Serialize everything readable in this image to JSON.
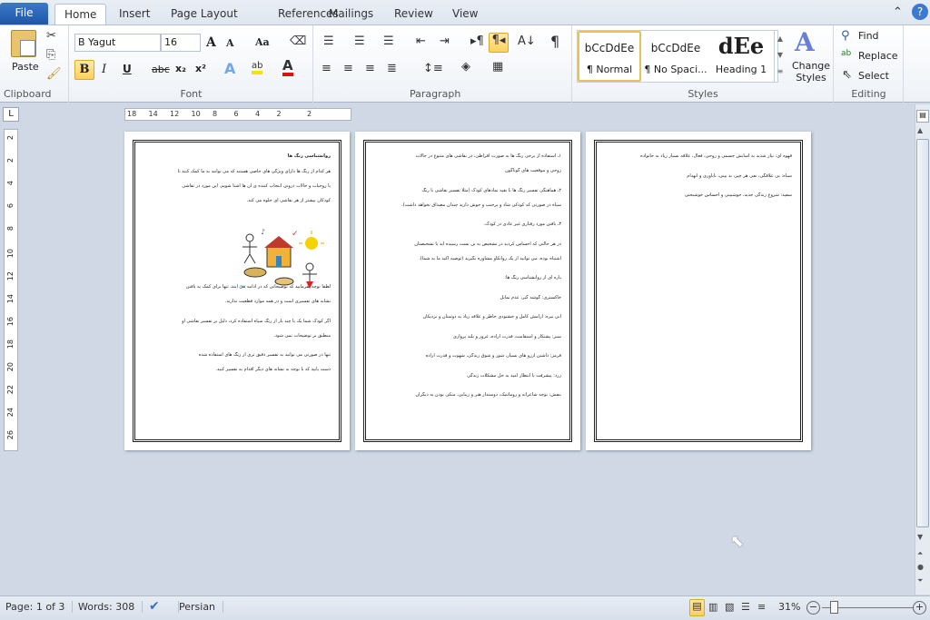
{
  "tabs": {
    "file": "File",
    "items": [
      "Home",
      "Insert",
      "Page Layout",
      "References",
      "Mailings",
      "Review",
      "View"
    ]
  },
  "clipboard": {
    "paste": "Paste",
    "label": "Clipboard"
  },
  "font": {
    "name": "B Yagut",
    "size": "16",
    "label": "Font",
    "bold": "B",
    "italic": "I",
    "underline": "U",
    "strike": "abc",
    "sub": "x₂",
    "sup": "x²",
    "case": "Aa",
    "grow": "A",
    "shrink": "A"
  },
  "paragraph": {
    "label": "Paragraph"
  },
  "styles": {
    "label": "Styles",
    "items": [
      {
        "preview": "bCcDdEe",
        "name": "¶ Normal"
      },
      {
        "preview": "bCcDdEe",
        "name": "¶ No Spaci..."
      },
      {
        "preview": "dEe",
        "name": "Heading 1"
      }
    ],
    "change": "Change Styles"
  },
  "editing": {
    "label": "Editing",
    "find": "Find",
    "replace": "Replace",
    "select": "Select"
  },
  "ruler": {
    "h": [
      "18",
      "14",
      "12",
      "10",
      "8",
      "6",
      "4",
      "2",
      "2"
    ],
    "v": [
      "2",
      "2",
      "4",
      "6",
      "8",
      "10",
      "12",
      "14",
      "16",
      "18",
      "20",
      "22",
      "24",
      "26"
    ]
  },
  "pages": [
    [
      "روانشناسی رنگ ها",
      "هر کدام از رنگ ها دارای ویژگی های خاصی هستند که می توانند به ما کمک کنند تا",
      "با روحیات و حالات درونی انتخاب کننده ی آن ها آشنا شویم. این مورد در نقاشی",
      "کودکان بیشتر از هر نقاشی ای جلوه می کند.",
      "لطفا توجه بفرمایید که توضیحاتی که در ادامه می آیند، تنها برای کمک به یافتن",
      "نشانه های تفسیری است و در همه موارد قطعیت ندارند.",
      "اگر کودک شما یک یا چند بار از رنگ سیاه استفاده کرد، دلیل بر تفسیر نقاشی او",
      "منطبق بر توضیحات نمی شود.",
      "تنها در صورتی می توانید به تفسیر دقیق تری از رنگ های استفاده شده",
      "دست یابید که با توجه به نشانه های دیگر اقدام به تفسیر کنید."
    ],
    [
      "۱ـ استفاده از برخی رنگ ها به صورت افراطی، در نقاشی های متنوع در حالات",
      "روحی و موقعیت های گوناگون",
      "۲ـ هماهنگی تفسیر رنگ ها با بقیه نمادهای کودک (مثلا تفسیر نقاشی با رنگ",
      "سیاه در صورتی که کودکی شاد و پرجنب و جوش دارید چندان مصداق نخواهد داشت).",
      "۳ـ یافتن مورد رفتاری غیر عادی در کودک.",
      "در هر حالتی که احساس کردید در تشخیص به بن بست رسیده اید یا تشخیصتان",
      "اشتباه بوده، می توانید از یک روانکاو مشاوره بگیرید (توصیه اکید ما به شما).",
      "پاره ای از روانشناسی رنگ ها:",
      "خاکستری: گوشه گیر، عدم تمایل",
      "آبی تیره: آرامش کامل و خشنودی خاطر و علاقه زیاد به دوستان و نزدیکان",
      "سبز: پشتکار و استقامت، قدرت اراده، غرور و بلند پروازی",
      "قرمز: داشتن آرزو های بسیار، شور و شوق زندگی، شهوت و قدرت اراده",
      "زرد: پیشرفت با انتظار امید به حل مشکلات زندگی",
      "بنفش: توجه شاعرانه و رومانتیک، دوستدار هنر و زیبایی، متکی بودن به دیگران"
    ],
    [
      "قهوه ای: نیاز شدید به آسایش جسمی و روحی، فعال، علاقه بسیار زیاد به خانواده",
      "سیاه: بی علاقگی، نفی هر چیز، بد بینی، ناباوری و انهدام",
      "سفید: شروع زندگی جدید، خوشبینی و احساس خوشبختی"
    ]
  ],
  "status": {
    "page": "Page: 1 of 3",
    "words": "Words: 308",
    "language": "Persian",
    "zoom": "31%"
  }
}
